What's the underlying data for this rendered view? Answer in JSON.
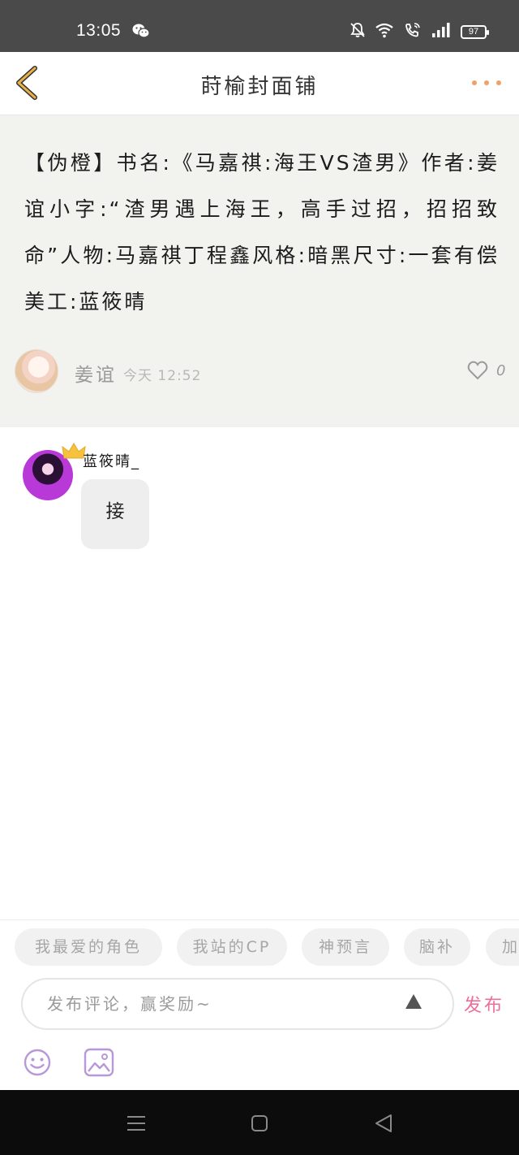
{
  "status_bar": {
    "time": "13:05",
    "battery": "97",
    "icons": [
      "wechat-icon",
      "mute-bell-icon",
      "wifi-icon",
      "volte-call-icon",
      "signal-icon",
      "battery-icon"
    ]
  },
  "nav": {
    "title": "莳榆封面铺",
    "back_icon": "chevron-left-icon",
    "more_icon": "more-dots-icon"
  },
  "post": {
    "content": "【伪橙】书名:《马嘉祺:海王VS渣男》作者:姜谊小字:“渣男遇上海王，高手过招，招招致命”人物:马嘉祺丁程鑫风格:暗黑尺寸:一套有偿美工:蓝筱晴",
    "author": "姜谊",
    "time": "今天 12:52",
    "likes": "0"
  },
  "comment": {
    "user": "蓝筱晴_",
    "text": "接"
  },
  "suggestions": [
    "我最爱的角色",
    "我站的CP",
    "神预言",
    "脑补",
    "加"
  ],
  "composer": {
    "placeholder": "发布评论，赢奖励~",
    "publish_label": "发布"
  },
  "colors": {
    "accent": "#ee6e9a",
    "back_arrow": "#e8b04a",
    "more_dots": "#f0a06a",
    "post_bg": "#f2f2ee",
    "toolbar_icon": "#b898d8"
  }
}
